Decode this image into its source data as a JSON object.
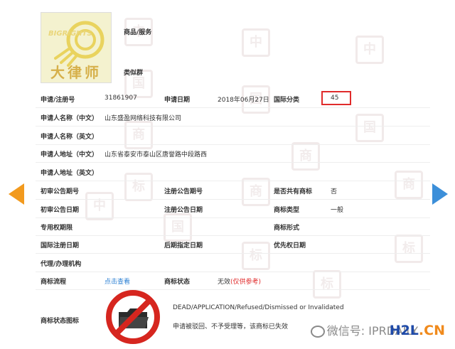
{
  "logo": {
    "brand": "BIGRIGHTS",
    "chinese": "大律师"
  },
  "rows": {
    "goods_label": "商品/服务",
    "similar_group_label": "类似群",
    "reg_no_label": "申请/注册号",
    "reg_no_value": "31861907",
    "app_date_label": "申请日期",
    "app_date_value": "2018年06月27日",
    "intl_class_label": "国际分类",
    "intl_class_value": "45",
    "applicant_cn_label": "申请人名称（中文）",
    "applicant_cn_value": "山东盛盈网络科技有限公司",
    "applicant_en_label": "申请人名称（英文）",
    "address_cn_label": "申请人地址（中文）",
    "address_cn_value": "山东省泰安市泰山区唐誉路中段路西",
    "address_en_label": "申请人地址（英文）",
    "prelim_issue_label": "初审公告期号",
    "reg_issue_label": "注册公告期号",
    "shared_label": "是否共有商标",
    "shared_value": "否",
    "prelim_date_label": "初审公告日期",
    "reg_date_label": "注册公告日期",
    "tm_type_label": "商标类型",
    "tm_type_value": "一般",
    "exclusive_label": "专用权期限",
    "tm_form_label": "商标形式",
    "intl_reg_date_label": "国际注册日期",
    "later_date_label": "后期指定日期",
    "priority_date_label": "优先权日期",
    "agent_label": "代理/办理机构",
    "process_label": "商标流程",
    "process_link": "点击查看",
    "status_label": "商标状态",
    "status_value": "无效",
    "status_note": "(仅供参考)",
    "status_icon_label": "商标状态图标",
    "status_en": "DEAD/APPLICATION/Refused/Dismissed or Invalidated",
    "status_cn": "申请被驳回、不予受理等，该商标已失效"
  },
  "watermark": {
    "wechat": "微信号: IPRDAILY",
    "site_a": "H2L",
    "site_b": ".CN"
  },
  "watermark_chars": [
    "中",
    "国",
    "商",
    "标",
    "中",
    "国",
    "商",
    "标",
    "中",
    "国",
    "商",
    "标",
    "中",
    "国",
    "商",
    "标"
  ],
  "colors": {
    "accent": "#e02b2b",
    "link": "#2a7fd3",
    "arrow_left": "#f29a1e",
    "arrow_right": "#3c8fd9"
  },
  "icons": {
    "prev": "arrow-left-icon",
    "next": "arrow-right-icon",
    "status": "no-folder-icon"
  }
}
